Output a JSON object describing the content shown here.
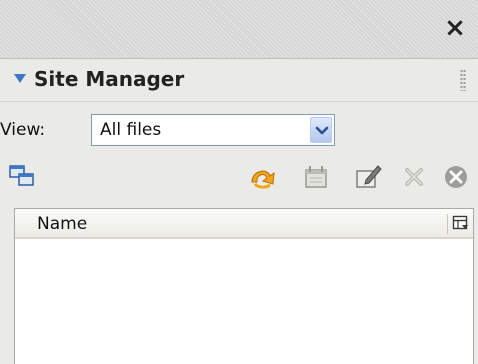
{
  "panel": {
    "close_label": "×",
    "title": "Site Manager",
    "view_label": "View:",
    "view_select": {
      "value": "All files"
    }
  },
  "toolbar": {
    "icons": [
      "switch-windows-icon",
      "refresh-icon",
      "new-folder-icon",
      "edit-icon",
      "delete-icon",
      "stop-icon"
    ]
  },
  "list": {
    "columns": [
      "Name"
    ],
    "rows": []
  },
  "colors": {
    "accent": "#3d77c6",
    "panel_bg": "#eaeae6",
    "titlebar_bg": "#d6d6d6"
  }
}
